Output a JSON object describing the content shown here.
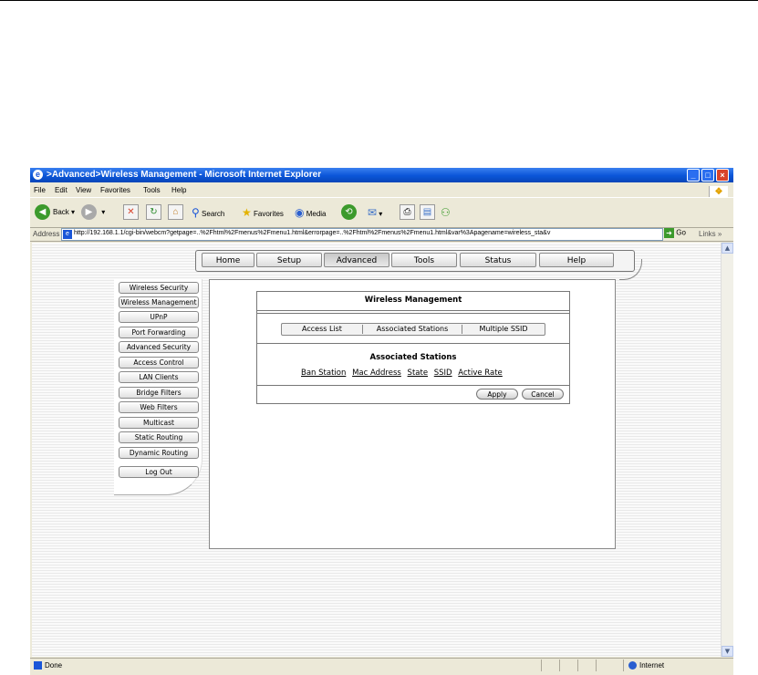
{
  "window": {
    "title": ">Advanced>Wireless Management - Microsoft Internet Explorer",
    "ie_icon": "internet-explorer-icon",
    "controls": {
      "minimize": "_",
      "maximize": "□",
      "close": "×"
    }
  },
  "menu": [
    "File",
    "Edit",
    "View",
    "Favorites",
    "Tools",
    "Help"
  ],
  "toolbar": {
    "back": "Back",
    "search": "Search",
    "favorites": "Favorites",
    "media": "Media"
  },
  "address": {
    "label": "Address",
    "url": "http://192.168.1.1/cgi-bin/webcm?getpage=..%2Fhtml%2Fmenus%2Fmenu1.html&errorpage=..%2Fhtml%2Fmenus%2Fmenu1.html&var%3Apagename=wireless_sta&v",
    "go": "Go",
    "links": "Links"
  },
  "nav_tabs": [
    {
      "label": "Home",
      "active": false
    },
    {
      "label": "Setup",
      "active": false
    },
    {
      "label": "Advanced",
      "active": true
    },
    {
      "label": "Tools",
      "active": false
    },
    {
      "label": "Status",
      "active": false
    },
    {
      "label": "Help",
      "active": false
    }
  ],
  "left_menu": [
    "Wireless Security",
    "Wireless Management",
    "UPnP",
    "Port Forwarding",
    "Advanced Security",
    "Access Control",
    "LAN Clients",
    "Bridge Filters",
    "Web Filters",
    "Multicast",
    "Static Routing",
    "Dynamic Routing",
    "Log Out"
  ],
  "panel": {
    "title": "Wireless Management",
    "subtabs": [
      "Access List",
      "Associated Stations",
      "Multiple SSID"
    ],
    "section_title": "Associated Stations",
    "columns": [
      "Ban Station",
      "Mac Address",
      "State",
      "SSID",
      "Active Rate"
    ],
    "apply": "Apply",
    "cancel": "Cancel"
  },
  "status": {
    "left": "Done",
    "zone": "Internet"
  }
}
